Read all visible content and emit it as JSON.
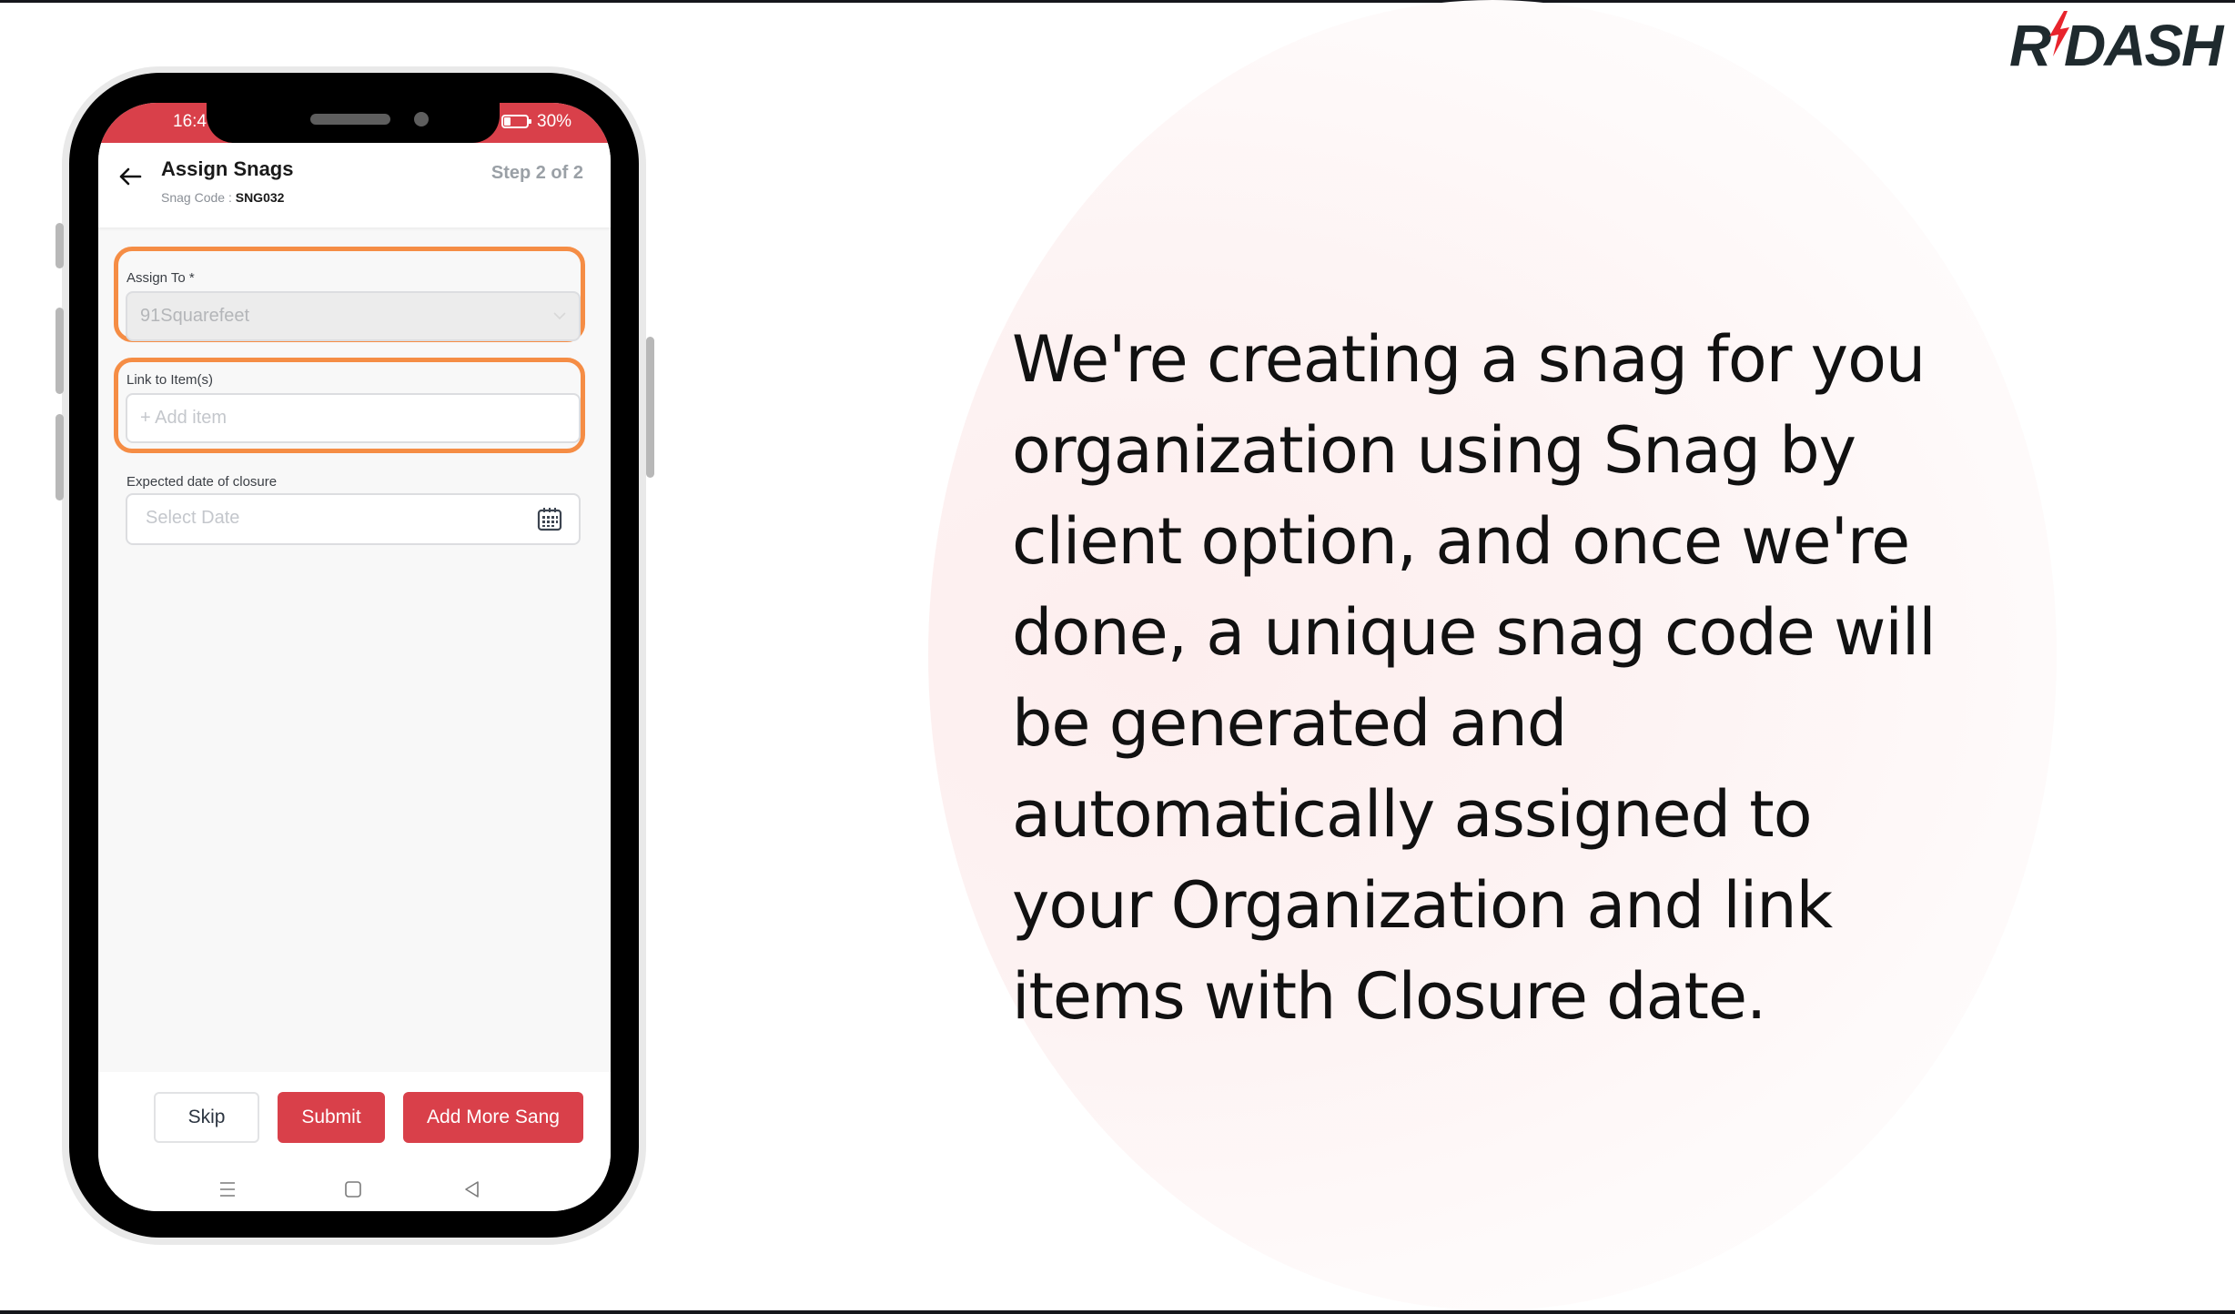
{
  "brand": {
    "logo_text": "R DASH",
    "accent_color": "#d9404a",
    "highlight_color": "#f58d45",
    "bolt_color": "#e8242c"
  },
  "phone": {
    "status_bar": {
      "time": "16:4",
      "battery_percent": "30%",
      "battery_level": 0.3
    },
    "header": {
      "title": "Assign Snags",
      "snag_code_label": "Snag Code :",
      "snag_code_value": "SNG032",
      "step": "Step 2 of 2"
    },
    "form": {
      "assign_to": {
        "label": "Assign To *",
        "value": "91Squarefeet",
        "disabled": true
      },
      "link_items": {
        "label": "Link to Item(s)",
        "placeholder": "+ Add item"
      },
      "closure_date": {
        "label": "Expected date of closure",
        "placeholder": "Select Date"
      }
    },
    "footer": {
      "skip_label": "Skip",
      "submit_label": "Submit",
      "add_more_label": "Add More Sang"
    },
    "nav": [
      "menu-icon",
      "home-icon",
      "back-triangle-icon"
    ]
  },
  "description": {
    "lines": [
      "We're creating a snag for you",
      "organization using Snag by",
      "client option, and once we're",
      "done, a unique snag code will",
      "be generated and",
      "automatically assigned to",
      "your Organization and link",
      "items with Closure date."
    ]
  }
}
